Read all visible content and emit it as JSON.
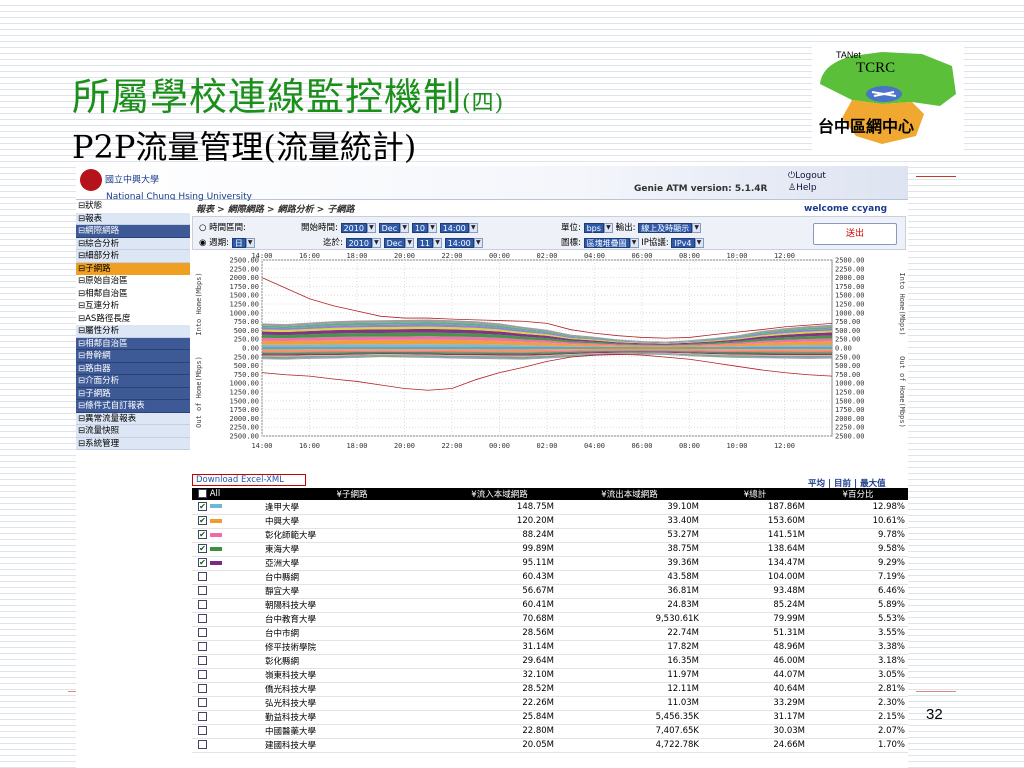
{
  "slide": {
    "title": "所屬學校連線監控機制",
    "title_suffix": "(四)",
    "subtitle": "P2P流量管理(流量統計)",
    "page_number": "32",
    "logo_tanet": "TANet",
    "logo_tcrc": "TCRC",
    "logo_caption": "台中區網中心"
  },
  "app": {
    "university_cn": "國立中興大學",
    "university_en": "National Chung Hsing University",
    "version": "Genie ATM version: 5.1.4R",
    "logout": "Logout",
    "help": "Help",
    "breadcrumb": "報表 > 網際網路 > 網路分析 > 子網路",
    "welcome": "welcome ccyang"
  },
  "menu": [
    {
      "label": "⊟狀態",
      "style": "w"
    },
    {
      "label": "⊟報表",
      "style": "light"
    },
    {
      "label": " ⊟網際網路",
      "style": "blue"
    },
    {
      "label": "   ⊟綜合分析",
      "style": "light"
    },
    {
      "label": "   ⊟細部分析",
      "style": "light"
    },
    {
      "label": "     ⊟子網路",
      "style": "sel"
    },
    {
      "label": "     ⊟原始自治區",
      "style": "w"
    },
    {
      "label": "     ⊟相鄰自治區",
      "style": "w"
    },
    {
      "label": "     ⊟互連分析",
      "style": "w"
    },
    {
      "label": "     ⊟AS路徑長度",
      "style": "w"
    },
    {
      "label": "   ⊟屬性分析",
      "style": "light"
    },
    {
      "label": " ⊟相鄰自治區",
      "style": "blue"
    },
    {
      "label": " ⊟骨幹網",
      "style": "blue"
    },
    {
      "label": " ⊟路由器",
      "style": "blue"
    },
    {
      "label": " ⊟介面分析",
      "style": "blue"
    },
    {
      "label": " ⊟子網路",
      "style": "blue"
    },
    {
      "label": " ⊟條件式自訂報表",
      "style": "blue"
    },
    {
      "label": "⊟異常流量報表",
      "style": "light"
    },
    {
      "label": "⊟流量快照",
      "style": "light"
    },
    {
      "label": "⊟系統管理",
      "style": "light"
    }
  ],
  "params": {
    "range_label": "時間區間:",
    "period_label": "週期:",
    "period_value": "日",
    "start_label": "開始時間:",
    "end_label": "迄於:",
    "start": {
      "year": "2010",
      "month": "Dec",
      "day": "10",
      "time": "14:00"
    },
    "end": {
      "year": "2010",
      "month": "Dec",
      "day": "11",
      "time": "14:00"
    },
    "unit_label": "單位:",
    "unit_value": "bps",
    "output_label": "輸出:",
    "output_value": "線上及時顯示",
    "chart_label": "圖標:",
    "chart_value": "區塊堆疊圖",
    "ip_label": "IP協議:",
    "ip_value": "IPv4",
    "submit": "送出"
  },
  "chart_data": {
    "type": "area",
    "x_ticks": [
      "14:00",
      "16:00",
      "18:00",
      "20:00",
      "22:00",
      "00:00",
      "02:00",
      "04:00",
      "06:00",
      "08:00",
      "10:00",
      "12:00"
    ],
    "y_ticks_in": [
      "2500.00",
      "2250.00",
      "2000.00",
      "1750.00",
      "1500.00",
      "1250.00",
      "1000.00",
      "750.00",
      "500.00",
      "250.00",
      "0.00"
    ],
    "y_ticks_out": [
      "250.00",
      "500.00",
      "750.00",
      "1000.00",
      "1250.00",
      "1500.00",
      "1750.00",
      "2000.00",
      "2250.00",
      "2500.00"
    ],
    "ylabel_in": "Into Home(Mbps)",
    "ylabel_out": "Out of Home(Mbps)",
    "ylim": [
      -2500,
      2500
    ],
    "series_colors": [
      "#6fb7d9",
      "#f09a30",
      "#ef6aa8",
      "#3c9040",
      "#7b2a82",
      "#d8d23a",
      "#8d7bd0",
      "#55aa88",
      "#999999"
    ],
    "in_hours": [
      0,
      1,
      2,
      3,
      4,
      5,
      6,
      7,
      8,
      9,
      10,
      11,
      12,
      13,
      14,
      15,
      16,
      17,
      18,
      19,
      20,
      21,
      22,
      23,
      24
    ],
    "in_total": [
      700,
      680,
      720,
      760,
      780,
      790,
      800,
      810,
      790,
      760,
      700,
      600,
      520,
      380,
      320,
      240,
      200,
      180,
      220,
      280,
      360,
      480,
      560,
      620,
      660
    ],
    "in_shares": [
      0.13,
      0.16,
      0.12,
      0.13,
      0.13,
      0.08,
      0.08,
      0.08,
      0.09
    ],
    "out_total": [
      -320,
      -330,
      -310,
      -300,
      -280,
      -260,
      -270,
      -280,
      -300,
      -310,
      -320,
      -330,
      -300,
      -260,
      -220,
      -200,
      -190,
      -200,
      -230,
      -260,
      -280,
      -290,
      -300,
      -310,
      -300
    ],
    "line_in": [
      2000,
      1700,
      1400,
      1200,
      1050,
      900,
      850,
      850,
      820,
      800,
      780,
      760,
      700,
      520,
      420,
      350,
      300,
      280,
      300,
      380,
      450,
      520,
      600,
      650,
      700
    ],
    "line_out": [
      -700,
      -760,
      -800,
      -880,
      -950,
      -1050,
      -1150,
      -1200,
      -1150,
      -900,
      -700,
      -550,
      -380,
      -260,
      -200,
      -180,
      -200,
      -260,
      -320,
      -420,
      -520,
      -620,
      -700,
      -760,
      -800
    ]
  },
  "download": "Download Excel-XML",
  "modes": {
    "avg": "平均",
    "current": "目前",
    "max": "最大值"
  },
  "table": {
    "all": "All",
    "headers": [
      "子網路",
      "流入本域網路",
      "流出本域網路",
      "總計",
      "百分比"
    ],
    "rows": [
      {
        "checked": true,
        "color": "#6fb7d9",
        "name": "逢甲大學",
        "in": "148.75M",
        "out": "39.10M",
        "total": "187.86M",
        "pct": "12.98%"
      },
      {
        "checked": true,
        "color": "#f09a30",
        "name": "中興大學",
        "in": "120.20M",
        "out": "33.40M",
        "total": "153.60M",
        "pct": "10.61%"
      },
      {
        "checked": true,
        "color": "#ef6aa8",
        "name": "彰化師範大學",
        "in": "88.24M",
        "out": "53.27M",
        "total": "141.51M",
        "pct": "9.78%"
      },
      {
        "checked": true,
        "color": "#3c9040",
        "name": "東海大學",
        "in": "99.89M",
        "out": "38.75M",
        "total": "138.64M",
        "pct": "9.58%"
      },
      {
        "checked": true,
        "color": "#7b2a82",
        "name": "亞洲大學",
        "in": "95.11M",
        "out": "39.36M",
        "total": "134.47M",
        "pct": "9.29%"
      },
      {
        "checked": false,
        "color": "",
        "name": "台中縣網",
        "in": "60.43M",
        "out": "43.58M",
        "total": "104.00M",
        "pct": "7.19%"
      },
      {
        "checked": false,
        "color": "",
        "name": "靜宜大學",
        "in": "56.67M",
        "out": "36.81M",
        "total": "93.48M",
        "pct": "6.46%"
      },
      {
        "checked": false,
        "color": "",
        "name": "朝陽科技大學",
        "in": "60.41M",
        "out": "24.83M",
        "total": "85.24M",
        "pct": "5.89%"
      },
      {
        "checked": false,
        "color": "",
        "name": "台中教育大學",
        "in": "70.68M",
        "out": "9,530.61K",
        "total": "79.99M",
        "pct": "5.53%"
      },
      {
        "checked": false,
        "color": "",
        "name": "台中市網",
        "in": "28.56M",
        "out": "22.74M",
        "total": "51.31M",
        "pct": "3.55%"
      },
      {
        "checked": false,
        "color": "",
        "name": "修平技術學院",
        "in": "31.14M",
        "out": "17.82M",
        "total": "48.96M",
        "pct": "3.38%"
      },
      {
        "checked": false,
        "color": "",
        "name": "彰化縣網",
        "in": "29.64M",
        "out": "16.35M",
        "total": "46.00M",
        "pct": "3.18%"
      },
      {
        "checked": false,
        "color": "",
        "name": "嶺東科技大學",
        "in": "32.10M",
        "out": "11.97M",
        "total": "44.07M",
        "pct": "3.05%"
      },
      {
        "checked": false,
        "color": "",
        "name": "僑光科技大學",
        "in": "28.52M",
        "out": "12.11M",
        "total": "40.64M",
        "pct": "2.81%"
      },
      {
        "checked": false,
        "color": "",
        "name": "弘光科技大學",
        "in": "22.26M",
        "out": "11.03M",
        "total": "33.29M",
        "pct": "2.30%"
      },
      {
        "checked": false,
        "color": "",
        "name": "勤益科技大學",
        "in": "25.84M",
        "out": "5,456.35K",
        "total": "31.17M",
        "pct": "2.15%"
      },
      {
        "checked": false,
        "color": "",
        "name": "中國醫藥大學",
        "in": "22.80M",
        "out": "7,407.65K",
        "total": "30.03M",
        "pct": "2.07%"
      },
      {
        "checked": false,
        "color": "",
        "name": "建國科技大學",
        "in": "20.05M",
        "out": "4,722.78K",
        "total": "24.66M",
        "pct": "1.70%"
      }
    ]
  }
}
